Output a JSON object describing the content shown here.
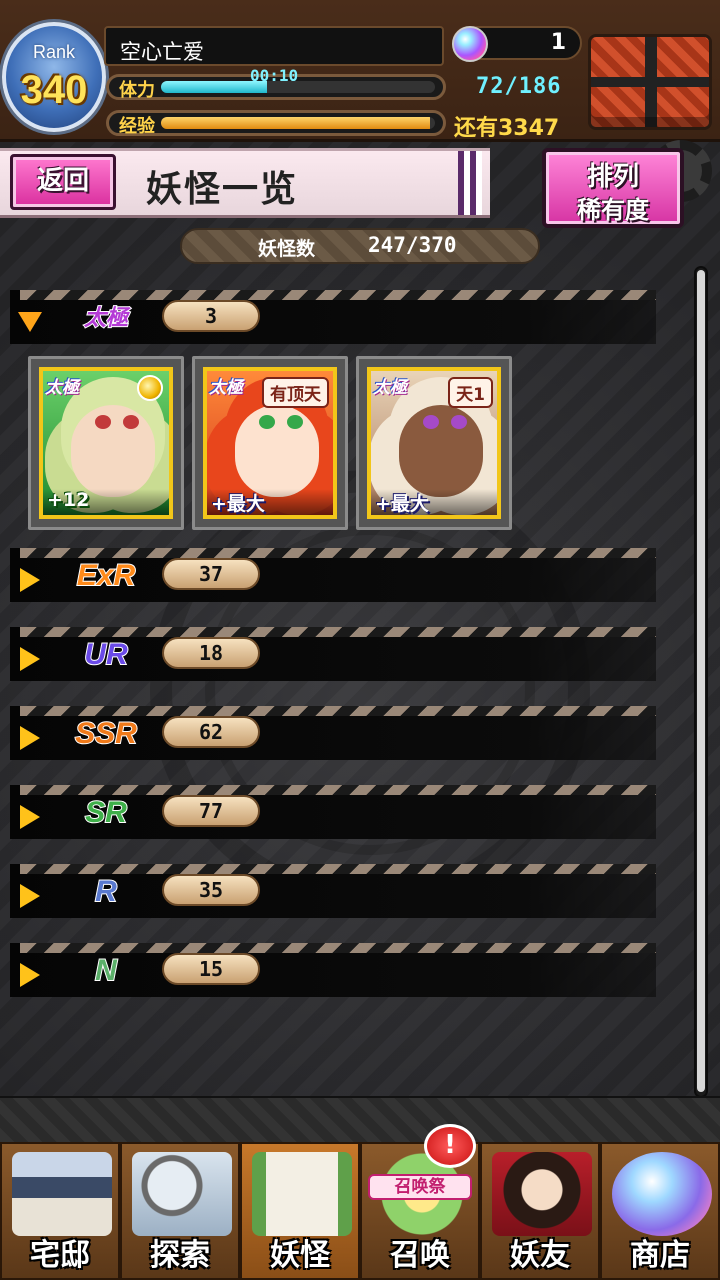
{
  "header": {
    "rank_label": "Rank",
    "rank_value": "340",
    "player_name": "空心亡爱",
    "stamina_label": "体力",
    "stamina_timer": "00:10",
    "stamina_count": "72/186",
    "stamina_fraction": 0.387,
    "exp_label": "经验",
    "exp_remaining": "还有3347",
    "exp_fraction": 0.98,
    "orb_count": "1"
  },
  "title_bar": {
    "back_label": "返回",
    "page_title": "妖怪一览",
    "sort_line1": "排列",
    "sort_line2": "稀有度"
  },
  "summary": {
    "count_label": "妖怪数",
    "count_value": "247/370"
  },
  "rarity_groups": [
    {
      "label": "太極",
      "count": "3",
      "expanded": true,
      "color": "#b43ad6"
    },
    {
      "label": "ExR",
      "count": "37",
      "expanded": false,
      "color": "#ff8a1a"
    },
    {
      "label": "UR",
      "count": "18",
      "expanded": false,
      "color": "#6a4ae8"
    },
    {
      "label": "SSR",
      "count": "62",
      "expanded": false,
      "color": "#f07a1a"
    },
    {
      "label": "SR",
      "count": "77",
      "expanded": false,
      "color": "#3fb04a"
    },
    {
      "label": "R",
      "count": "35",
      "expanded": false,
      "color": "#5a7ad0"
    },
    {
      "label": "N",
      "count": "15",
      "expanded": false,
      "color": "#5bb06a"
    }
  ],
  "cards": [
    {
      "badge": "太極",
      "tag": "",
      "level": "+12",
      "medal": true,
      "theme": "green"
    },
    {
      "badge": "太極",
      "tag": "有顶天",
      "level": "+最大",
      "medal": false,
      "theme": "red"
    },
    {
      "badge": "太極",
      "tag": "天1",
      "level": "+最大",
      "medal": false,
      "theme": "tan"
    }
  ],
  "nav": [
    {
      "label": "宅邸",
      "icon": "mansion-icon",
      "active": false
    },
    {
      "label": "探索",
      "icon": "magnifier-map-icon",
      "active": false
    },
    {
      "label": "妖怪",
      "icon": "scroll-icon",
      "active": true
    },
    {
      "label": "召唤",
      "icon": "summon-star-icon",
      "active": false
    },
    {
      "label": "妖友",
      "icon": "fox-girl-icon",
      "active": false
    },
    {
      "label": "商店",
      "icon": "crystal-orb-icon",
      "active": false
    }
  ],
  "nav_alert": "!",
  "summon_banner": "召唤祭",
  "colors": {
    "accent_pink": "#d92e9e",
    "stamina_cyan": "#35d6e6",
    "exp_gold": "#f2a019",
    "arrow_yellow": "#ffc21a"
  }
}
